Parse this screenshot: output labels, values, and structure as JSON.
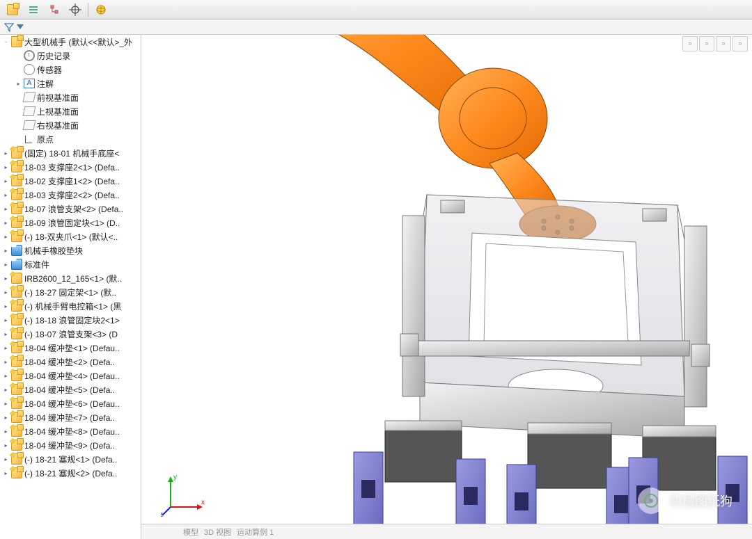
{
  "toolbar_icons": [
    "assembly",
    "list",
    "tree-config",
    "target",
    "globe"
  ],
  "right_toolbar": [
    "a",
    "b",
    "c",
    "d",
    "e",
    "f"
  ],
  "filter_row": {
    "placeholder": ""
  },
  "tree": {
    "root": {
      "label": "大型机械手  (默认<<默认>_外",
      "icon": "assembly",
      "expander": "-"
    },
    "items": [
      {
        "icon": "history",
        "label": "历史记录",
        "indent": 1
      },
      {
        "icon": "sensor",
        "label": "传感器",
        "indent": 1
      },
      {
        "icon": "annot",
        "label": "注解",
        "indent": 1,
        "expander": "▸"
      },
      {
        "icon": "plane",
        "label": "前视基准面",
        "indent": 1
      },
      {
        "icon": "plane",
        "label": "上视基准面",
        "indent": 1
      },
      {
        "icon": "plane",
        "label": "右视基准面",
        "indent": 1
      },
      {
        "icon": "origin",
        "label": "原点",
        "indent": 1
      },
      {
        "icon": "assembly",
        "label": "(固定) 18-01 机械手底座<",
        "indent": 0,
        "expander": "▸",
        "editable": true
      },
      {
        "icon": "assembly",
        "label": "18-03 支撑座2<1> (Defa..",
        "indent": 0,
        "expander": "▸",
        "editable": true
      },
      {
        "icon": "assembly",
        "label": "18-02 支撑座1<2> (Defa..",
        "indent": 0,
        "expander": "▸",
        "editable": true
      },
      {
        "icon": "assembly",
        "label": "18-03 支撑座2<2> (Defa..",
        "indent": 0,
        "expander": "▸",
        "editable": true
      },
      {
        "icon": "assembly",
        "label": "18-07 浪管支架<2> (Defa..",
        "indent": 0,
        "expander": "▸",
        "editable": true
      },
      {
        "icon": "assembly",
        "label": "18-09 浪管固定块<1> (D..",
        "indent": 0,
        "expander": "▸",
        "editable": true
      },
      {
        "icon": "assembly",
        "label": "(-) 18-双夹爪<1> (默认<..",
        "indent": 0,
        "expander": "▸",
        "editable": true
      },
      {
        "icon": "folder",
        "label": "机械手橡胶垫块",
        "indent": 0,
        "expander": "▸"
      },
      {
        "icon": "folder",
        "label": "标准件",
        "indent": 0,
        "expander": "▸"
      },
      {
        "icon": "part",
        "label": "IRB2600_12_165<1> (默..",
        "indent": 0,
        "expander": "▸",
        "editable": true
      },
      {
        "icon": "assembly",
        "label": "(-) 18-27 固定架<1> (默..",
        "indent": 0,
        "expander": "▸",
        "editable": true
      },
      {
        "icon": "assembly",
        "label": "(-) 机械手臂电控箱<1> (黑",
        "indent": 0,
        "expander": "▸",
        "editable": true
      },
      {
        "icon": "assembly",
        "label": "(-) 18-18 浪管固定块2<1>",
        "indent": 0,
        "expander": "▸",
        "editable": true
      },
      {
        "icon": "assembly",
        "label": "(-) 18-07 浪管支架<3> (D",
        "indent": 0,
        "expander": "▸",
        "editable": true
      },
      {
        "icon": "assembly",
        "label": "18-04 缓冲垫<1> (Defau..",
        "indent": 0,
        "expander": "▸",
        "editable": true
      },
      {
        "icon": "assembly",
        "label": "18-04 缓冲垫<2> (Defa..",
        "indent": 0,
        "expander": "▸",
        "editable": true
      },
      {
        "icon": "assembly",
        "label": "18-04 缓冲垫<4> (Defau..",
        "indent": 0,
        "expander": "▸",
        "editable": true
      },
      {
        "icon": "assembly",
        "label": "18-04 缓冲垫<5> (Defa..",
        "indent": 0,
        "expander": "▸",
        "editable": true
      },
      {
        "icon": "assembly",
        "label": "18-04 缓冲垫<6> (Defau..",
        "indent": 0,
        "expander": "▸",
        "editable": true
      },
      {
        "icon": "assembly",
        "label": "18-04 缓冲垫<7> (Defa..",
        "indent": 0,
        "expander": "▸",
        "editable": true
      },
      {
        "icon": "assembly",
        "label": "18-04 缓冲垫<8> (Defau..",
        "indent": 0,
        "expander": "▸",
        "editable": true
      },
      {
        "icon": "assembly",
        "label": "18-04 缓冲垫<9> (Defa..",
        "indent": 0,
        "expander": "▸",
        "editable": true
      },
      {
        "icon": "assembly",
        "label": "(-) 18-21 塞规<1> (Defa..",
        "indent": 0,
        "expander": "▸",
        "editable": true
      },
      {
        "icon": "assembly",
        "label": "(-) 18-21 塞规<2> (Defa..",
        "indent": 0,
        "expander": "▸",
        "editable": true
      }
    ]
  },
  "bottom_tabs": [
    "模型",
    "3D 视图",
    "运动算例 1"
  ],
  "triad": {
    "x": "x",
    "y": "y",
    "z": "z"
  },
  "watermark": {
    "text": "机械图纸狗"
  },
  "viewport_desc": "3D view of an orange industrial robot arm wrist attached to a translucent rectangular gripper fixture with metallic rails and four purple clamp feet"
}
